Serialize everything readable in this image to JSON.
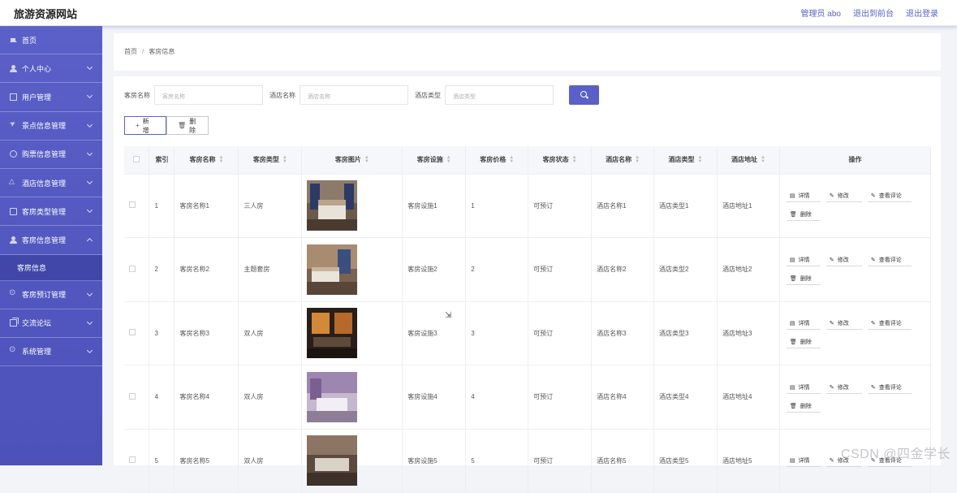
{
  "header": {
    "site_title": "旅游资源网站",
    "admin_label": "管理员 abo",
    "to_front_label": "退出到前台",
    "logout_label": "退出登录"
  },
  "sidebar": {
    "items": [
      {
        "label": "首页",
        "icon": "home-icon"
      },
      {
        "label": "个人中心",
        "icon": "user-icon"
      },
      {
        "label": "用户管理",
        "icon": "card-icon"
      },
      {
        "label": "景点信息管理",
        "icon": "plane-icon"
      },
      {
        "label": "购票信息管理",
        "icon": "circle-icon"
      },
      {
        "label": "酒店信息管理",
        "icon": "triangle-icon"
      },
      {
        "label": "客房类型管理",
        "icon": "box-icon"
      },
      {
        "label": "客房信息管理",
        "icon": "user-icon"
      },
      {
        "label": "客房预订管理",
        "icon": "dots-icon"
      },
      {
        "label": "交流论坛",
        "icon": "copy-icon"
      },
      {
        "label": "系统管理",
        "icon": "dots-icon"
      }
    ],
    "active_sub": "客房信息"
  },
  "breadcrumb": {
    "home": "首页",
    "current": "客房信息"
  },
  "search": {
    "room_name_label": "客房名称",
    "room_name_placeholder": "客房名称",
    "hotel_name_label": "酒店名称",
    "hotel_name_placeholder": "酒店名称",
    "hotel_type_label": "酒店类型",
    "hotel_type_placeholder": "酒店类型"
  },
  "actions": {
    "add_label": "新增",
    "delete_label": "删除"
  },
  "table": {
    "headers": {
      "index": "索引",
      "name": "客房名称",
      "type": "客房类型",
      "image": "客房图片",
      "facility": "客房设施",
      "price": "客房价格",
      "status": "客房状态",
      "hotel_name": "酒店名称",
      "hotel_type": "酒店类型",
      "hotel_addr": "酒店地址",
      "ops": "操作"
    },
    "op_labels": {
      "detail": "详情",
      "edit": "修改",
      "review": "查看评论",
      "delete": "删除"
    },
    "rows": [
      {
        "index": "1",
        "name": "客房名称1",
        "type": "三人房",
        "facility": "客房设施1",
        "price": "1",
        "status": "可预订",
        "hotel_name": "酒店名称1",
        "hotel_type": "酒店类型1",
        "hotel_addr": "酒店地址1"
      },
      {
        "index": "2",
        "name": "客房名称2",
        "type": "主题套房",
        "facility": "客房设施2",
        "price": "2",
        "status": "可预订",
        "hotel_name": "酒店名称2",
        "hotel_type": "酒店类型2",
        "hotel_addr": "酒店地址2"
      },
      {
        "index": "3",
        "name": "客房名称3",
        "type": "双人房",
        "facility": "客房设施3",
        "price": "3",
        "status": "可预订",
        "hotel_name": "酒店名称3",
        "hotel_type": "酒店类型3",
        "hotel_addr": "酒店地址3"
      },
      {
        "index": "4",
        "name": "客房名称4",
        "type": "双人房",
        "facility": "客房设施4",
        "price": "4",
        "status": "可预订",
        "hotel_name": "酒店名称4",
        "hotel_type": "酒店类型4",
        "hotel_addr": "酒店地址4"
      },
      {
        "index": "5",
        "name": "客房名称5",
        "type": "双人房",
        "facility": "客房设施5",
        "price": "5",
        "status": "可预订",
        "hotel_name": "酒店名称5",
        "hotel_type": "酒店类型5",
        "hotel_addr": "酒店地址5"
      }
    ]
  },
  "watermark": "CSDN @四金学长",
  "colors": {
    "accent": "#5a60c8",
    "sidebar": "#5157bf"
  }
}
